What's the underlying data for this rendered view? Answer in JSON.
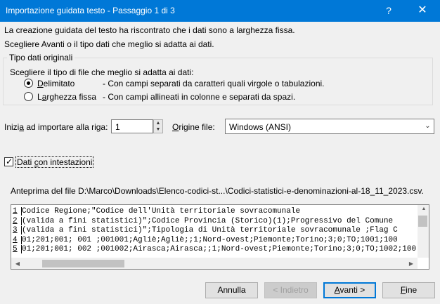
{
  "window": {
    "title": "Importazione guidata testo - Passaggio 1 di 3",
    "help_glyph": "?",
    "close_glyph": "✕"
  },
  "intro": {
    "line1": "La creazione guidata del testo ha riscontrato che i dati sono a larghezza fissa.",
    "line2": "Scegliere Avanti o il tipo dati che meglio si adatta ai dati."
  },
  "original_type": {
    "legend": "Tipo dati originali",
    "prompt": "Scegliere il tipo di file che meglio si adatta ai dati:",
    "options": [
      {
        "label_pre": "",
        "label_u": "D",
        "label_post": "elimitato",
        "description": "- Con campi separati da caratteri quali virgole o tabulazioni.",
        "selected": true
      },
      {
        "label_pre": "L",
        "label_u": "a",
        "label_post": "rghezza fissa",
        "description": "- Con campi allineati in colonne e separati da spazi.",
        "selected": false
      }
    ]
  },
  "start_row": {
    "label_pre": "Inizi",
    "label_u": "a",
    "label_post": " ad importare alla riga:",
    "value": "1"
  },
  "file_origin": {
    "label_pre": "",
    "label_u": "O",
    "label_post": "rigine file:",
    "value": "Windows (ANSI)"
  },
  "headers_checkbox": {
    "label_pre": "Dati ",
    "label_u": "c",
    "label_post": "on intestazioni",
    "checked": true
  },
  "preview": {
    "label": "Anteprima del file D:\\Marco\\Downloads\\Elenco-codici-st...\\Codici-statistici-e-denominazioni-al-18_11_2023.csv.",
    "lines": [
      {
        "num": "1",
        "text": "Codice Regione;\"Codice dell'Unità territoriale sovracomunale "
      },
      {
        "num": "2",
        "text": "(valida a fini statistici)\";Codice Provincia (Storico)(1);Progressivo del Comune"
      },
      {
        "num": "3",
        "text": "(valida a fini statistici)\";Tipologia di Unità territoriale sovracomunale ;Flag C"
      },
      {
        "num": "4",
        "text": "01;201;001; 001 ;001001;Agliè;Agliè;;1;Nord-ovest;Piemonte;Torino;3;0;TO;1001;100"
      },
      {
        "num": "5",
        "text": "01;201;001; 002 ;001002;Airasca;Airasca;;1;Nord-ovest;Piemonte;Torino;3;0;TO;1002;100"
      }
    ]
  },
  "buttons": {
    "cancel": "Annulla",
    "back": "< Indietro",
    "next_u": "A",
    "next_post": "vanti >",
    "finish_u": "F",
    "finish_post": "ine"
  }
}
